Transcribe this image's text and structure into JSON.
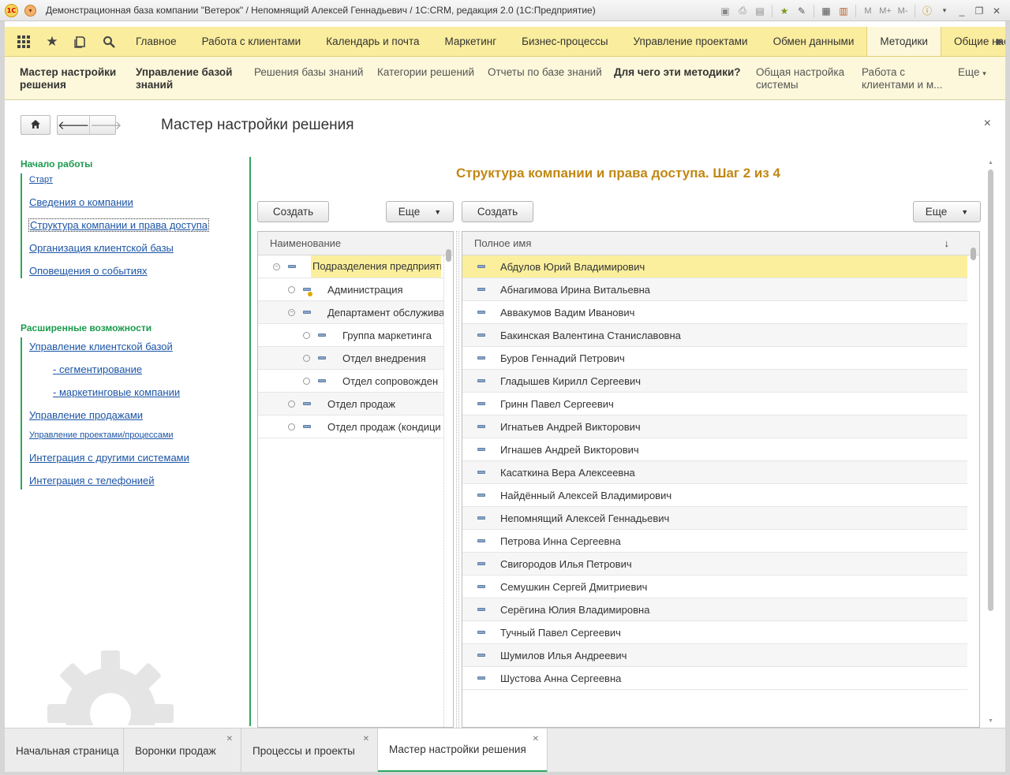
{
  "window": {
    "title": "Демонстрационная база компании \"Ветерок\" / Непомнящий Алексей Геннадьевич / 1С:CRM, редакция 2.0  (1С:Предприятие)",
    "tool_labels": [
      "M",
      "M+",
      "M-"
    ]
  },
  "sections": [
    {
      "label": "Главное",
      "left": 0
    },
    {
      "label": "Работа с клиентами"
    },
    {
      "label": "Календарь и почта"
    },
    {
      "label": "Маркетинг"
    },
    {
      "label": "Бизнес-процессы"
    },
    {
      "label": "Управление проектами"
    },
    {
      "label": "Обмен данными"
    },
    {
      "label": "Методики"
    },
    {
      "label": "Общие настрой"
    }
  ],
  "functions": {
    "item1": "Мастер настройки решения",
    "item2": "Управление базой знаний",
    "item3": "Решения базы знаний",
    "item4": "Категории решений",
    "item5": "Отчеты по базе знаний",
    "item6": "Для чего эти методики?",
    "item7": "Общая настройка системы",
    "item8": "Работа с клиентами и м...",
    "more": "Еще"
  },
  "form": {
    "title": "Мастер настройки решения",
    "close": "×",
    "step_title": "Структура компании и права доступа. Шаг 2 из 4"
  },
  "nav": {
    "group1_title": "Начало работы",
    "start": "Старт",
    "company_info": "Сведения о компании",
    "structure": "Структура компании и права доступа",
    "client_base": "Организация клиентской базы",
    "notifications": "Оповещения о событиях",
    "group2_title": "Расширенные возможности",
    "client_mgmt": "Управление клиентской базой",
    "segmentation": "- сегментирование",
    "marketing_campaigns": "- маркетинговые компании",
    "sales_mgmt": "Управление продажами",
    "projects": "Управление проектами/процессами",
    "integration": "Интеграция с другими системами",
    "telephony": "Интеграция с телефонией"
  },
  "left_panel": {
    "create": "Создать",
    "more": "Еще",
    "column": "Наименование",
    "rows": [
      {
        "label": "Подразделения предприяти"
      },
      {
        "label": "Администрация"
      },
      {
        "label": "Департамент обслужива"
      },
      {
        "label": "Группа маркетинга"
      },
      {
        "label": "Отдел внедрения"
      },
      {
        "label": "Отдел сопровожден"
      },
      {
        "label": "Отдел продаж"
      },
      {
        "label": "Отдел продаж (кондици"
      }
    ]
  },
  "right_panel": {
    "create": "Создать",
    "more": "Еще",
    "column": "Полное имя",
    "sort_icon": "↓",
    "rows": [
      "Абдулов Юрий Владимирович",
      "Абнагимова Ирина Витальевна",
      "Аввакумов Вадим Иванович",
      "Бакинская Валентина Станиславовна",
      "Буров Геннадий Петрович",
      "Гладышев Кирилл Сергеевич",
      "Гринн Павел Сергеевич",
      "Игнатьев Андрей Викторович",
      "Игнашев Андрей Викторович",
      "Касаткина Вера Алексеевна",
      "Найдённый Алексей Владимирович",
      "Непомнящий Алексей Геннадьевич",
      "Петрова Инна Сергеевна",
      "Свигородов Илья Петрович",
      "Семушкин Сергей Дмитриевич",
      "Серёгина Юлия Владимировна",
      "Тучный Павел Сергеевич",
      "Шумилов Илья Андреевич",
      "Шустова Анна Сергеевна"
    ]
  },
  "open_tabs": [
    {
      "label": "Начальная страница"
    },
    {
      "label": "Воронки продаж"
    },
    {
      "label": "Процессы и проекты"
    },
    {
      "label": "Мастер настройки решения"
    }
  ],
  "colors": {
    "accent_green": "#2fa55e",
    "step_title": "#c18814",
    "sections_bg": "#fbed9e",
    "selection": "#fbef9d"
  }
}
